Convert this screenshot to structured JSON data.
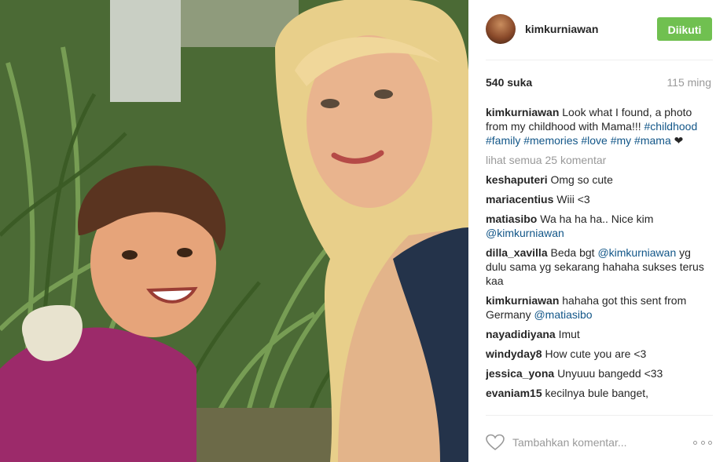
{
  "post": {
    "username": "kimkurniawan",
    "follow_label": "Diikuti",
    "likes": "540 suka",
    "time_ago": "115 ming",
    "caption": {
      "user": "kimkurniawan",
      "text": "Look what I found, a photo from my childhood with Mama!!! ",
      "emoji_placeholder": "",
      "hashtags": "#childhood #family #memories #love #my #mama",
      "heart": "❤"
    },
    "view_all_comments": "lihat semua 25 komentar"
  },
  "comments": [
    {
      "user": "keshaputeri",
      "text": "Omg so cute"
    },
    {
      "user": "mariacentius",
      "text": "Wiii <3"
    },
    {
      "user": "matiasibo",
      "text": "Wa ha ha ha.. Nice kim ",
      "mention": "@kimkurniawan"
    },
    {
      "user": "dilla_xavilla",
      "text_before": "Beda bgt ",
      "mention": "@kimkurniawan",
      "text_after": " yg dulu sama yg sekarang hahaha ",
      "glyph1": "",
      "text_after2": " sukses terus kaa ",
      "glyph2": ""
    },
    {
      "user": "kimkurniawan",
      "text": "hahaha got this sent from Germany ",
      "glyph": "",
      "mention": " @matiasibo"
    },
    {
      "user": "nayadidiyana",
      "text": "Imut"
    },
    {
      "user": "windyday8",
      "text": "How cute you are <3"
    },
    {
      "user": "jessica_yona",
      "text": "Unyuuu bangedd <33"
    },
    {
      "user": "evaniam15",
      "text": "kecilnya bule banget,"
    }
  ],
  "footer": {
    "add_comment_placeholder": "Tambahkan komentar..."
  },
  "colors": {
    "follow_button": "#70c050",
    "link": "#125688",
    "muted": "#999999",
    "text": "#262626"
  },
  "icons": [
    "heart-icon",
    "more-options-icon"
  ]
}
